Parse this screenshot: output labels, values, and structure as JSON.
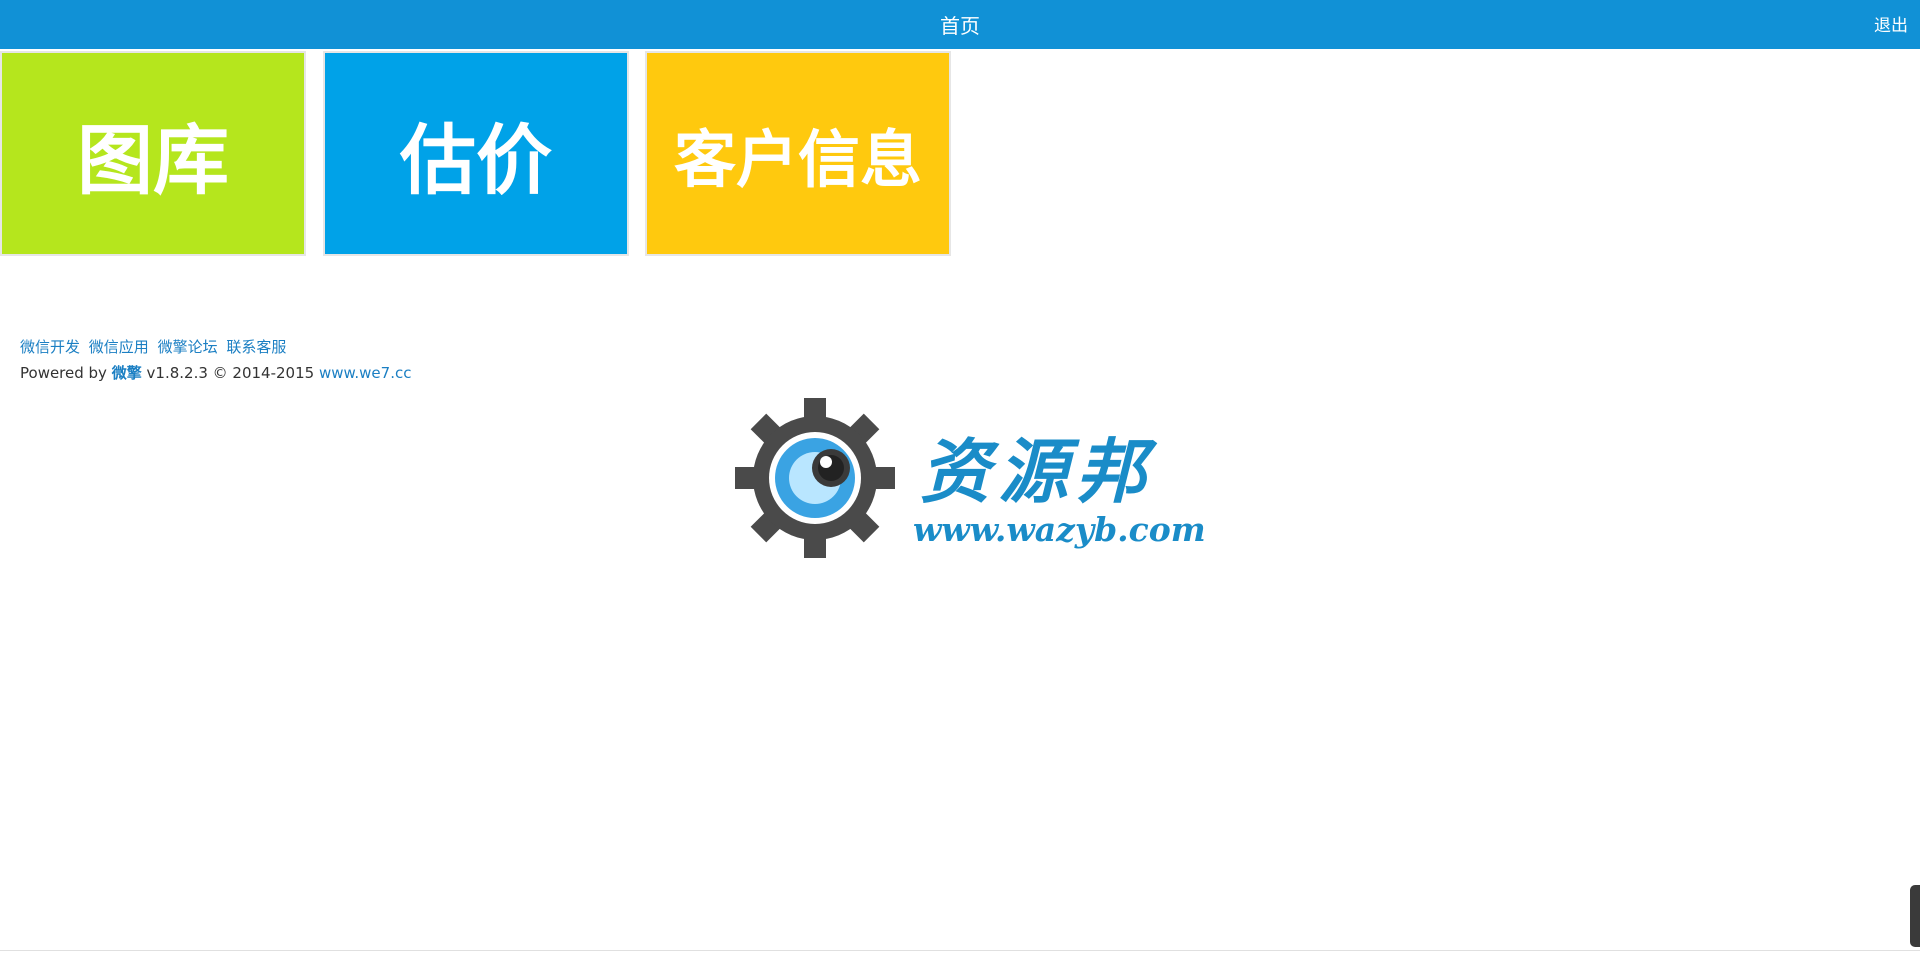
{
  "header": {
    "title": "首页",
    "logout_label": "退出",
    "background": "#1191d6"
  },
  "tiles": [
    {
      "label": "图库",
      "color": "#b5e61d"
    },
    {
      "label": "估价",
      "color": "#00a2e8"
    },
    {
      "label": "客户信息",
      "color": "#ffc90e"
    }
  ],
  "footer": {
    "links": [
      "微信开发",
      "微信应用",
      "微擎论坛",
      "联系客服"
    ],
    "powered_prefix": "Powered by",
    "brand": "微擎",
    "version_text": "v1.8.2.3 © 2014-2015",
    "site_link": "www.we7.cc"
  },
  "watermark": {
    "icon": "gear-eye-icon",
    "title": "资源邦",
    "url": "www.wazyb.com"
  }
}
